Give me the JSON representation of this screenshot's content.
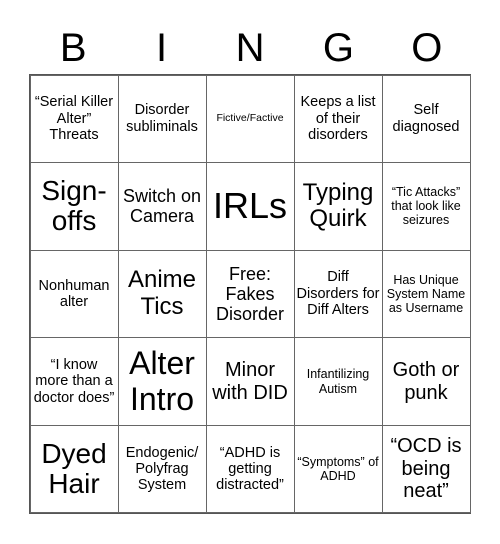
{
  "header": {
    "letters": [
      "B",
      "I",
      "N",
      "G",
      "O"
    ]
  },
  "cells": [
    {
      "text": "“Serial Killer Alter” Threats",
      "size": "s14"
    },
    {
      "text": "Disorder subliminals",
      "size": "s14"
    },
    {
      "text": "Fictive/Factive",
      "size": "s10"
    },
    {
      "text": "Keeps a list of their disorders",
      "size": "s14"
    },
    {
      "text": "Self diagnosed",
      "size": "s14"
    },
    {
      "text": "Sign-offs",
      "size": "s28"
    },
    {
      "text": "Switch on Camera",
      "size": "s18"
    },
    {
      "text": "IRLs",
      "size": "s36"
    },
    {
      "text": "Typing Quirk",
      "size": "s24"
    },
    {
      "text": "“Tic Attacks” that look like seizures",
      "size": "s12"
    },
    {
      "text": "Nonhuman alter",
      "size": "s14"
    },
    {
      "text": "Anime Tics",
      "size": "s24"
    },
    {
      "text": "Free: Fakes Disorder",
      "size": "s18"
    },
    {
      "text": "Diff Disorders for Diff Alters",
      "size": "s14"
    },
    {
      "text": "Has Unique System Name as Username",
      "size": "s12"
    },
    {
      "text": "“I know more than a doctor does”",
      "size": "s14"
    },
    {
      "text": "Alter Intro",
      "size": "s32"
    },
    {
      "text": "Minor with DID",
      "size": "s20"
    },
    {
      "text": "Infantilizing Autism",
      "size": "s12"
    },
    {
      "text": "Goth or punk",
      "size": "s20"
    },
    {
      "text": "Dyed Hair",
      "size": "s28"
    },
    {
      "text": "Endogenic/ Polyfrag System",
      "size": "s14"
    },
    {
      "text": "“ADHD is getting distracted”",
      "size": "s14"
    },
    {
      "text": "“Symptoms” of ADHD",
      "size": "s12"
    },
    {
      "text": "“OCD is being neat”",
      "size": "s20"
    }
  ]
}
